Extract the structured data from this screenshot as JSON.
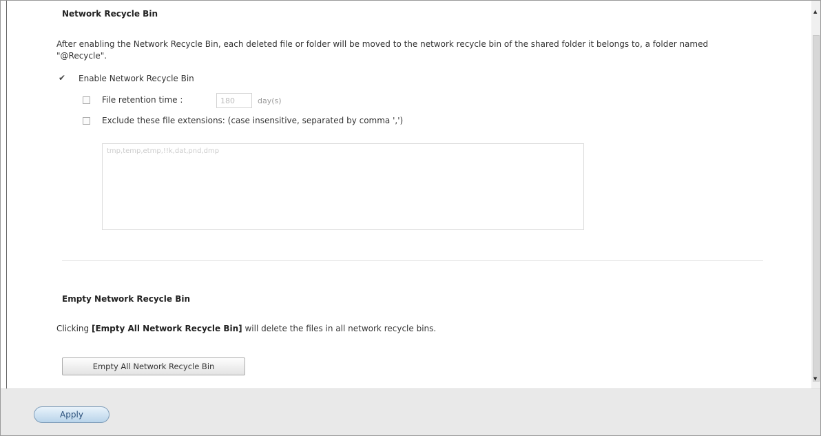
{
  "recycle_section": {
    "title": "Network Recycle Bin",
    "description": "After enabling the Network Recycle Bin, each deleted file or folder will be moved to the network recycle bin of the shared folder it belongs to, a folder named \"@Recycle\".",
    "enable_label": "Enable Network Recycle Bin",
    "enable_checked": true,
    "retention_label": "File retention time :",
    "retention_value": "180",
    "retention_unit": "day(s)",
    "retention_checked": false,
    "exclude_label": "Exclude these file extensions: (case insensitive, separated by comma ',')",
    "exclude_checked": false,
    "exclude_value": "tmp,temp,etmp,!!k,dat,pnd,dmp"
  },
  "empty_section": {
    "title": "Empty Network Recycle Bin",
    "desc_prefix": "Clicking ",
    "desc_bold": "[Empty All Network Recycle Bin]",
    "desc_suffix": " will delete the files in all network recycle bins.",
    "button_label": "Empty All Network Recycle Bin"
  },
  "footer": {
    "apply_label": "Apply"
  },
  "icons": {
    "scroll_up": "scroll-up-arrow-icon",
    "scroll_down": "scroll-down-arrow-icon"
  }
}
